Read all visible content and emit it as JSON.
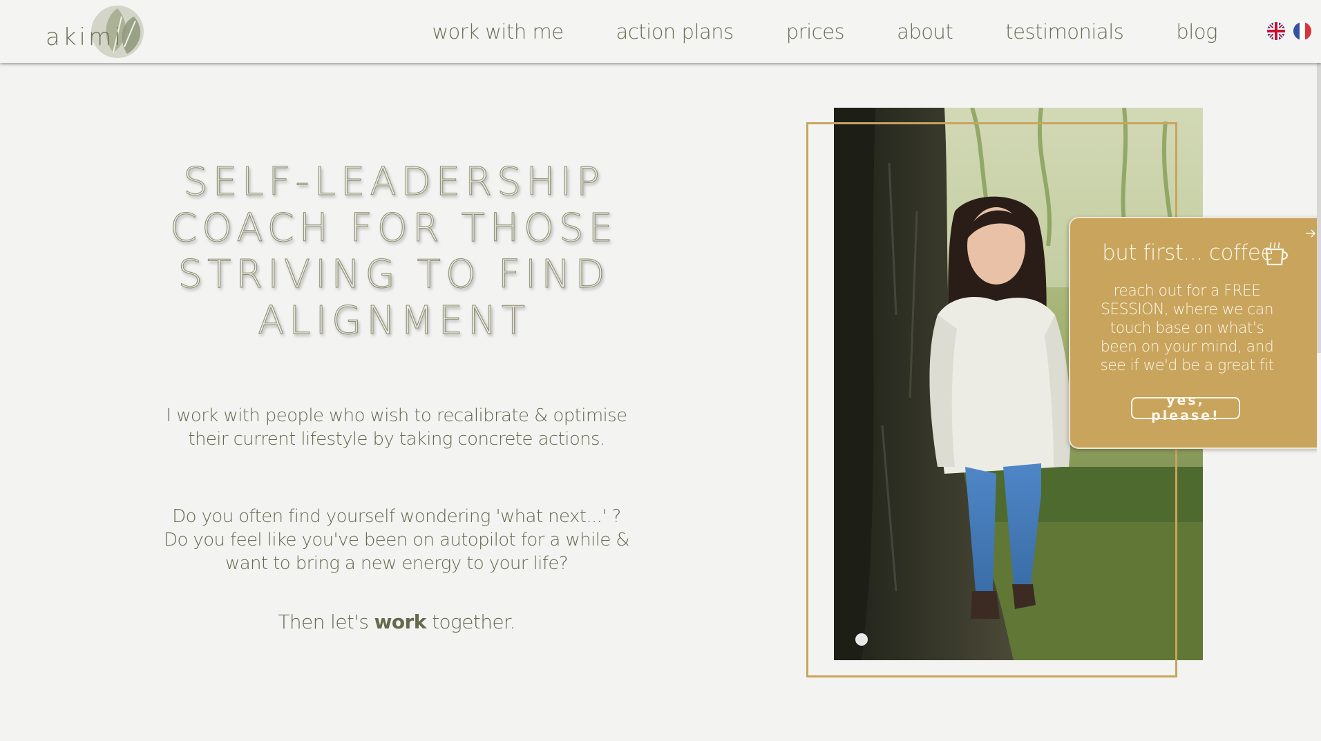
{
  "header": {
    "logo_text": "akimi",
    "nav": [
      "work with me",
      "action plans",
      "prices",
      "about",
      "testimonials",
      "blog"
    ],
    "languages": [
      "English",
      "Français"
    ]
  },
  "hero": {
    "title": "SELF-LEADERSHIP COACH FOR THOSE STRIVING TO FIND ALIGNMENT",
    "paragraph1": "I work with people who wish to recalibrate & optimise their current lifestyle by taking concrete actions.",
    "paragraph2": "Do you often find yourself wondering 'what next...' ? Do you feel like you've been on autopilot for a while & want to bring a new energy to your life?",
    "cta_before": "Then let's ",
    "cta_bold": "work",
    "cta_after": " together."
  },
  "popup": {
    "title": "but first... coffee",
    "text": "reach out for a FREE SESSION, where we can touch base on what's been on your mind, and see if we'd be a great fit",
    "button": "yes, please!"
  },
  "colors": {
    "accent_gold": "#c9a45c",
    "text_olive": "#66694d",
    "background": "#f3f3f2"
  }
}
